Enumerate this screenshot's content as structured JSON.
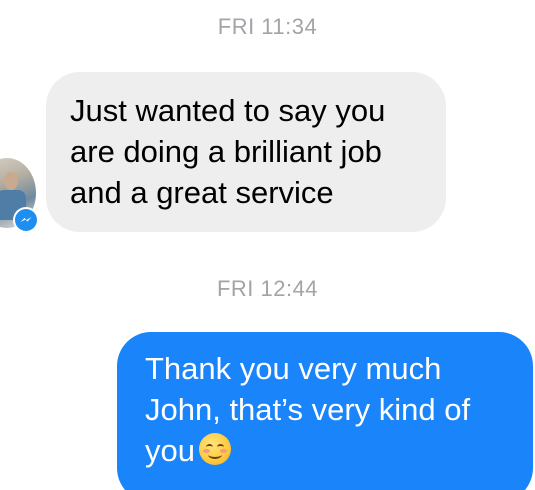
{
  "conversation": {
    "timestamps": [
      "FRI 11:34",
      "FRI 12:44"
    ],
    "messages": [
      {
        "sender": "contact",
        "lines": [
          "Just wanted to say you",
          "are doing a brilliant job",
          "and a great service"
        ]
      },
      {
        "sender": "self",
        "lines": [
          "Thank you very much",
          "John, that’s very kind of",
          "you"
        ],
        "emoji": "smiling-face-icon"
      }
    ]
  },
  "contact": {
    "avatar_icon": "avatar",
    "badge_icon": "messenger-icon"
  },
  "colors": {
    "outgoing_bubble": "#1a84fb",
    "incoming_bubble": "#eeeeef",
    "timestamp_text": "#a3a3a8",
    "badge": "#1f8ef1"
  }
}
